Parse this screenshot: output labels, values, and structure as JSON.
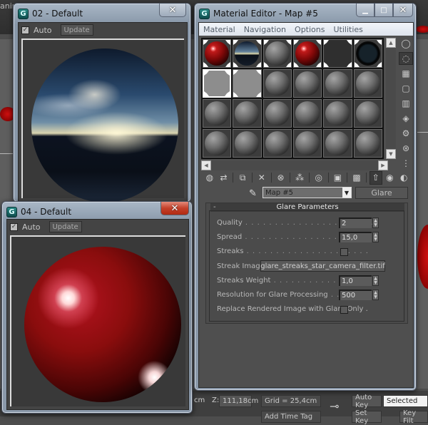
{
  "background": {
    "menu_fragment": "anim",
    "auto_key_label": "Auto Key",
    "set_key_label": "Set Key",
    "selected_value": "Selected",
    "key_filters_label": "Key Filt",
    "coord_z_label": "Z:",
    "coord_z_value": "111,18cm",
    "coord_y_fragment": "cm",
    "grid_text": "Grid = 25,4cm",
    "add_time_tag": "Add Time Tag",
    "key_icon": "key-icon"
  },
  "preview_02": {
    "title": "02 - Default",
    "auto_label": "Auto",
    "auto_checked": true,
    "update_label": "Update",
    "close_label": "✕"
  },
  "preview_04": {
    "title": "04 - Default",
    "auto_label": "Auto",
    "auto_checked": true,
    "update_label": "Update",
    "close_label": "✕"
  },
  "material_editor": {
    "title": "Material Editor - Map #5",
    "window_buttons": {
      "minimize": "▁",
      "maximize": "□",
      "close": "✕"
    },
    "menu": [
      "Material",
      "Navigation",
      "Options",
      "Utilities"
    ],
    "slots": [
      {
        "type": "red"
      },
      {
        "type": "sky"
      },
      {
        "type": "gray"
      },
      {
        "type": "red"
      },
      {
        "type": "noise"
      },
      {
        "type": "dark"
      },
      {
        "type": "flat",
        "active": true
      },
      {
        "type": "flat"
      },
      {
        "type": "gray"
      },
      {
        "type": "gray"
      },
      {
        "type": "gray"
      },
      {
        "type": "gray"
      },
      {
        "type": "gray"
      },
      {
        "type": "gray"
      },
      {
        "type": "gray"
      },
      {
        "type": "gray"
      },
      {
        "type": "gray"
      },
      {
        "type": "gray"
      },
      {
        "type": "gray"
      },
      {
        "type": "gray"
      },
      {
        "type": "gray"
      },
      {
        "type": "gray"
      },
      {
        "type": "gray"
      },
      {
        "type": "gray"
      }
    ],
    "side_tools": [
      {
        "name": "sample-type-icon",
        "glyph": "◯"
      },
      {
        "name": "backlight-icon",
        "glyph": "◌",
        "pressed": true
      },
      {
        "name": "background-icon",
        "glyph": "▦"
      },
      {
        "name": "sample-uv-tiling-icon",
        "glyph": "▢"
      },
      {
        "name": "video-color-check-icon",
        "glyph": "▥"
      },
      {
        "name": "make-preview-icon",
        "glyph": "◈"
      },
      {
        "name": "options-icon",
        "glyph": "⚙"
      },
      {
        "name": "select-by-material-icon",
        "glyph": "⊛"
      },
      {
        "name": "material-map-navigator-icon",
        "glyph": "⋮"
      }
    ],
    "toolbar": [
      {
        "name": "get-material-icon",
        "glyph": "◍"
      },
      {
        "name": "put-to-scene-icon",
        "glyph": "⇄"
      },
      {
        "sep": true
      },
      {
        "name": "assign-to-selection-icon",
        "glyph": "⧉"
      },
      {
        "sep": true
      },
      {
        "name": "reset-map-icon",
        "glyph": "✕"
      },
      {
        "sep": true
      },
      {
        "name": "make-unique-icon",
        "glyph": "⊗"
      },
      {
        "sep": true
      },
      {
        "name": "put-to-library-icon",
        "glyph": "⁂"
      },
      {
        "sep": true
      },
      {
        "name": "material-id-channel-icon",
        "glyph": "◎"
      },
      {
        "sep": true
      },
      {
        "name": "show-in-viewport-icon",
        "glyph": "▣"
      },
      {
        "sep": true
      },
      {
        "name": "show-end-result-icon",
        "glyph": "▩"
      },
      {
        "sep": true
      },
      {
        "name": "go-to-parent-icon",
        "glyph": "⇧",
        "pressed": true
      },
      {
        "name": "go-forward-to-sibling-icon",
        "glyph": "◉"
      },
      {
        "name": "go-to-sibling-icon",
        "glyph": "◐"
      }
    ],
    "map_name": "Map #5",
    "map_type": "Glare",
    "rollout": {
      "title": "Glare Parameters",
      "collapse": "-",
      "quality_label": "Quality",
      "quality_value": "2",
      "spread_label": "Spread",
      "spread_value": "15,0",
      "streaks_label": "Streaks",
      "streaks_checked": false,
      "streak_image_label": "Streak Image .",
      "streak_image_file": "glare_streaks_star_camera_filter.tif",
      "streaks_weight_label": "Streaks Weight",
      "streaks_weight_value": "1,0",
      "resolution_label": "Resolution for Glare Processing",
      "resolution_value": "500",
      "replace_label": "Replace Rendered Image with Glare Only .",
      "replace_checked": false
    }
  }
}
